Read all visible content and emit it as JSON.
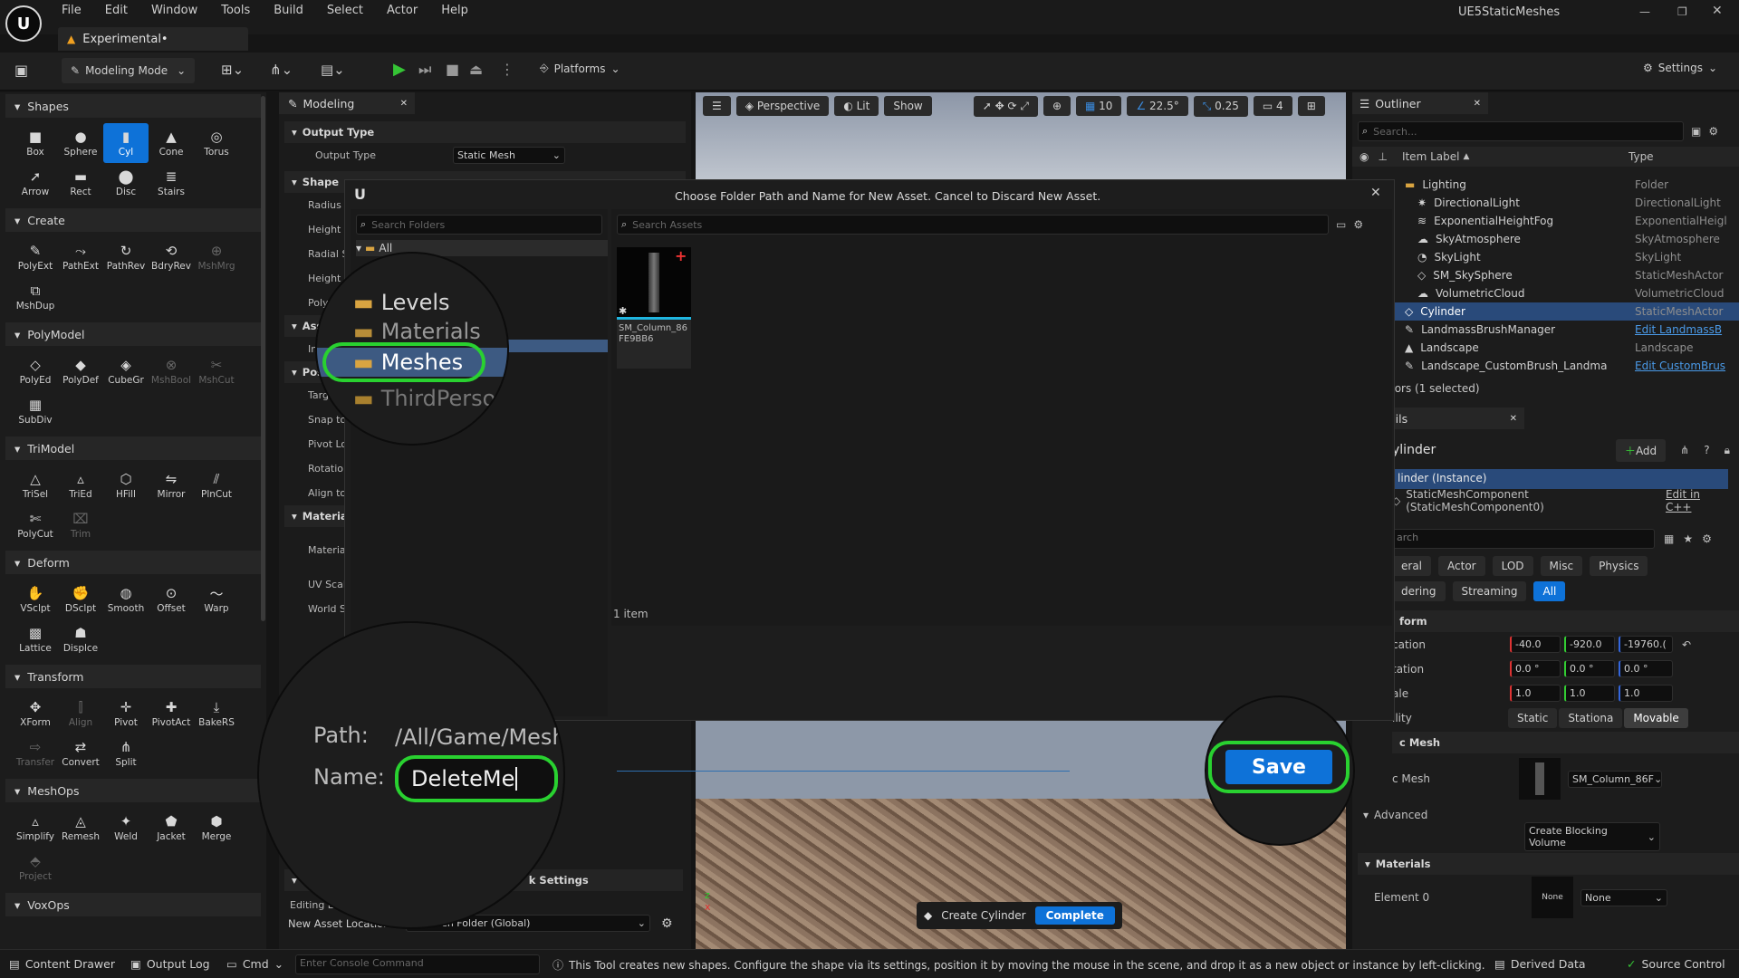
{
  "title_bar": {
    "menu": [
      "File",
      "Edit",
      "Window",
      "Tools",
      "Build",
      "Select",
      "Actor",
      "Help"
    ],
    "project_tab": "Experimental•",
    "project_name": "UE5StaticMeshes"
  },
  "toolbar": {
    "mode": "Modeling Mode",
    "platforms": "Platforms",
    "settings": "Settings"
  },
  "palette": {
    "sections": [
      {
        "name": "Shapes",
        "tools": [
          [
            "Box",
            ""
          ],
          [
            "Sphere",
            ""
          ],
          [
            "Cyl",
            "sel"
          ],
          [
            "Cone",
            ""
          ],
          [
            "Torus",
            ""
          ],
          [
            "Arrow",
            ""
          ],
          [
            "Rect",
            ""
          ],
          [
            "Disc",
            ""
          ],
          [
            "Stairs",
            ""
          ]
        ]
      },
      {
        "name": "Create",
        "tools": [
          [
            "PolyExt",
            ""
          ],
          [
            "PathExt",
            ""
          ],
          [
            "PathRev",
            ""
          ],
          [
            "BdryRev",
            ""
          ],
          [
            "MshMrg",
            "dis"
          ],
          [
            "MshDup",
            ""
          ]
        ]
      },
      {
        "name": "PolyModel",
        "tools": [
          [
            "PolyEd",
            ""
          ],
          [
            "PolyDef",
            ""
          ],
          [
            "CubeGr",
            ""
          ],
          [
            "MshBool",
            "dis"
          ],
          [
            "MshCut",
            "dis"
          ],
          [
            "SubDiv",
            ""
          ]
        ]
      },
      {
        "name": "TriModel",
        "tools": [
          [
            "TriSel",
            ""
          ],
          [
            "TriEd",
            ""
          ],
          [
            "HFill",
            ""
          ],
          [
            "Mirror",
            ""
          ],
          [
            "PlnCut",
            ""
          ],
          [
            "PolyCut",
            ""
          ],
          [
            "Trim",
            "dis"
          ]
        ]
      },
      {
        "name": "Deform",
        "tools": [
          [
            "VSclpt",
            ""
          ],
          [
            "DSclpt",
            ""
          ],
          [
            "Smooth",
            ""
          ],
          [
            "Offset",
            ""
          ],
          [
            "Warp",
            ""
          ],
          [
            "Lattice",
            ""
          ],
          [
            "Displce",
            ""
          ]
        ]
      },
      {
        "name": "Transform",
        "tools": [
          [
            "XForm",
            ""
          ],
          [
            "Align",
            "dis"
          ],
          [
            "Pivot",
            ""
          ],
          [
            "PivotAct",
            ""
          ],
          [
            "BakeRS",
            ""
          ],
          [
            "Transfer",
            "dis"
          ],
          [
            "Convert",
            ""
          ],
          [
            "Split",
            ""
          ]
        ]
      },
      {
        "name": "MeshOps",
        "tools": [
          [
            "Simplify",
            ""
          ],
          [
            "Remesh",
            ""
          ],
          [
            "Weld",
            ""
          ],
          [
            "Jacket",
            ""
          ],
          [
            "Merge",
            ""
          ],
          [
            "Project",
            "dis"
          ]
        ]
      },
      {
        "name": "VoxOps",
        "tools": []
      }
    ]
  },
  "modeling_panel": {
    "tab": "Modeling",
    "output_type_section": "Output Type",
    "output_type_label": "Output Type",
    "output_type_value": "Static Mesh",
    "shape_section": "Shape",
    "shape_rows": [
      "Radius",
      "Height",
      "Radial Sli",
      "Height Su",
      "Polygr"
    ],
    "asset_section": "Ass",
    "asset_rows": [
      "Ins"
    ],
    "position_section": "Pos",
    "position_rows": [
      "Targe",
      "Snap to G",
      "Pivot Loc",
      "Rotation",
      "Align to N"
    ],
    "material_section": "Material",
    "material_rows": [
      "Material",
      "UV Scale",
      "World S"
    ],
    "bottom_section": "k Settings",
    "editing_label": "Editing L",
    "new_asset_location_label": "New Asset Location",
    "new_asset_location_value": "AutoGen Folder (Global)"
  },
  "viewport": {
    "perspective": "Perspective",
    "lit": "Lit",
    "show": "Show",
    "grid_snap": "10",
    "angle_snap": "22.5°",
    "scale_snap": "0.25",
    "camera_speed": "4",
    "tool_label": "Create Cylinder",
    "complete_button": "Complete"
  },
  "outliner": {
    "tab": "Outliner",
    "search_placeholder": "Search...",
    "col_label": "Item Label",
    "col_type": "Type",
    "rows": [
      {
        "label": "Lighting",
        "type": "Folder",
        "indent": 1,
        "icon": "folder-icon"
      },
      {
        "label": "DirectionalLight",
        "type": "DirectionalLight",
        "indent": 2,
        "icon": "sun-icon"
      },
      {
        "label": "ExponentialHeightFog",
        "type": "ExponentialHeigl",
        "indent": 2,
        "icon": "fog-icon"
      },
      {
        "label": "SkyAtmosphere",
        "type": "SkyAtmosphere",
        "indent": 2,
        "icon": "sky-icon"
      },
      {
        "label": "SkyLight",
        "type": "SkyLight",
        "indent": 2,
        "icon": "light-icon"
      },
      {
        "label": "SM_SkySphere",
        "type": "StaticMeshActor",
        "indent": 2,
        "icon": "mesh-icon"
      },
      {
        "label": "VolumetricCloud",
        "type": "VolumetricCloud",
        "indent": 2,
        "icon": "cloud-icon"
      },
      {
        "label": "Cylinder",
        "type": "StaticMeshActor",
        "indent": 1,
        "icon": "mesh-icon",
        "selected": true
      },
      {
        "label": "LandmassBrushManager",
        "type": "Edit LandmassB",
        "indent": 1,
        "icon": "brush-icon",
        "link": true
      },
      {
        "label": "Landscape",
        "type": "Landscape",
        "indent": 1,
        "icon": "landscape-icon"
      },
      {
        "label": "Landscape_CustomBrush_Landma",
        "type": "Edit CustomBrus",
        "indent": 1,
        "icon": "brush-icon",
        "link": true
      }
    ],
    "footer": "tors (1 selected)"
  },
  "details": {
    "tab": "ails",
    "name": "ylinder",
    "add_button": "Add",
    "instance_row": "linder (Instance)",
    "component_row": "StaticMeshComponent (StaticMeshComponent0)",
    "edit_cpp": "Edit in C++",
    "search_placeholder": "arch",
    "filters_row1": [
      "eral",
      "Actor",
      "LOD",
      "Misc",
      "Physics"
    ],
    "filters_row2": [
      "dering",
      "Streaming",
      "All"
    ],
    "transform_section": "form",
    "location_label": "cation",
    "location": [
      "-40.0",
      "-920.0",
      "-19760.("
    ],
    "rotation_label": "tation",
    "rotation": [
      "0.0 °",
      "0.0 °",
      "0.0 °"
    ],
    "scale_label": "ale",
    "scale": [
      "1.0",
      "1.0",
      "1.0"
    ],
    "mobility_label": "ility",
    "mobility": [
      "Static",
      "Stationa",
      "Movable"
    ],
    "mesh_section": "c Mesh",
    "mesh_label": "c Mesh",
    "mesh_value": "SM_Column_86F",
    "advanced": "Advanced",
    "blocking_volume": "Create Blocking Volume",
    "materials_section": "Materials",
    "element0": "Element 0",
    "material_value": "None",
    "material_thumb": "None"
  },
  "dialog": {
    "title": "Choose Folder Path and Name for New Asset. Cancel to Discard New Asset.",
    "search_folders_placeholder": "Search Folders",
    "search_assets_placeholder": "Search Assets",
    "tree_root": "All",
    "folders": [
      "Levels",
      "Materials",
      "Meshes",
      "ThirdPerson"
    ],
    "asset_name": "SM_Column_86FE9BB6",
    "item_count": "1 item",
    "path_label": "Path:",
    "path_value": "/All/Game/Mesh",
    "name_label": "Name:",
    "name_value": "DeleteMe",
    "save_button": "Save"
  },
  "status_bar": {
    "content_drawer": "Content Drawer",
    "output_log": "Output Log",
    "cmd": "Cmd",
    "console_placeholder": "Enter Console Command",
    "hint": "This Tool creates new shapes. Configure the shape via its settings, position it by moving the mouse in the scene, and drop it as a new object or instance by left-clicking.",
    "derived_data": "Derived Data",
    "source_control": "Source Control"
  },
  "colors": {
    "accent": "#0e72d8",
    "highlight_green": "#29d130",
    "selected_row": "#294a7a"
  }
}
